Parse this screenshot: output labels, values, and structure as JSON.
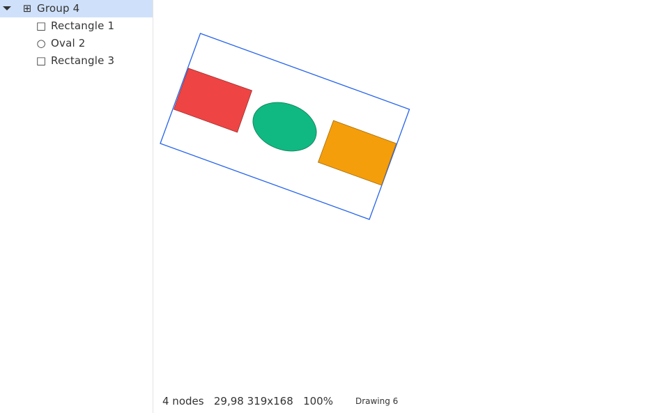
{
  "tree": {
    "items": [
      {
        "label": "Group 4",
        "glyph": "⊞",
        "icon": "group-icon",
        "depth": 0,
        "expanded": true,
        "selected": true
      },
      {
        "label": "Rectangle 1",
        "glyph": "□",
        "icon": "rectangle-icon",
        "depth": 1,
        "selected": false
      },
      {
        "label": "Oval 2",
        "glyph": "○",
        "icon": "oval-icon",
        "depth": 1,
        "selected": false
      },
      {
        "label": "Rectangle 3",
        "glyph": "□",
        "icon": "rectangle-icon",
        "depth": 1,
        "selected": false
      }
    ]
  },
  "canvas": {
    "shapes": [
      {
        "name": "Rectangle 1",
        "kind": "rectangle",
        "fill": "#ef4444"
      },
      {
        "name": "Oval 2",
        "kind": "oval",
        "fill": "#10b981"
      },
      {
        "name": "Rectangle 3",
        "kind": "rectangle",
        "fill": "#f59e0b"
      }
    ],
    "selection_color": "#2563eb"
  },
  "status": {
    "node_count": "4 nodes",
    "position": "29,98",
    "size": "319x168",
    "zoom": "100%",
    "document": "Drawing 6"
  }
}
